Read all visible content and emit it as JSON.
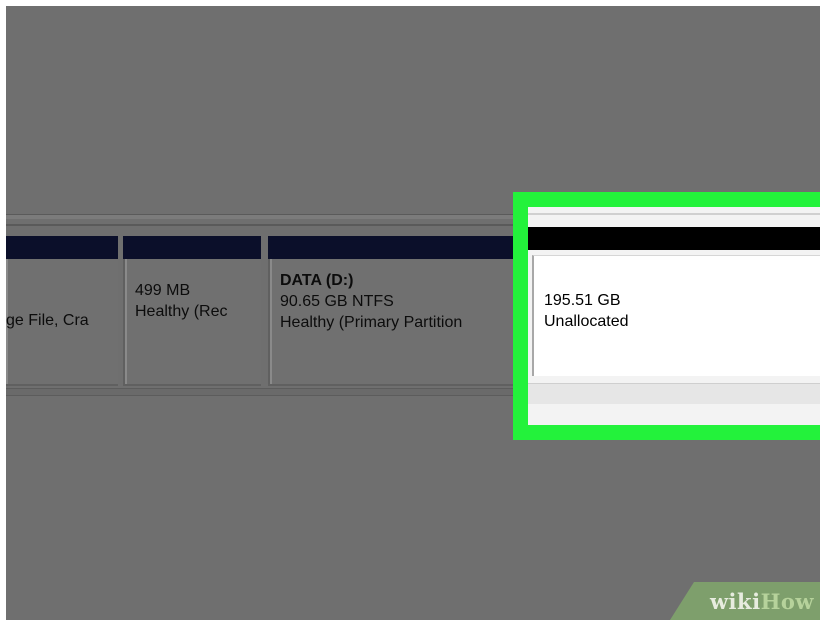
{
  "partitions": [
    {
      "line1": "",
      "line2": "",
      "line3": "ge File, Cra"
    },
    {
      "line1": "",
      "line2": "499 MB",
      "line3": "Healthy (Rec"
    },
    {
      "line1": "DATA  (D:)",
      "line2": "90.65 GB NTFS",
      "line3": "Healthy (Primary Partition"
    }
  ],
  "unallocated": {
    "size": "195.51 GB",
    "status": "Unallocated"
  },
  "highlight_color": "#23f23b",
  "watermark": {
    "part1": "wiki",
    "part2": "How"
  }
}
